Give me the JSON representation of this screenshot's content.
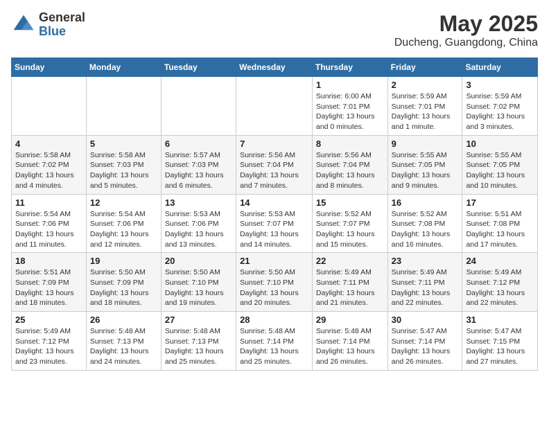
{
  "header": {
    "logo_general": "General",
    "logo_blue": "Blue",
    "month_year": "May 2025",
    "location": "Ducheng, Guangdong, China"
  },
  "weekdays": [
    "Sunday",
    "Monday",
    "Tuesday",
    "Wednesday",
    "Thursday",
    "Friday",
    "Saturday"
  ],
  "weeks": [
    [
      {
        "day": "",
        "info": ""
      },
      {
        "day": "",
        "info": ""
      },
      {
        "day": "",
        "info": ""
      },
      {
        "day": "",
        "info": ""
      },
      {
        "day": "1",
        "info": "Sunrise: 6:00 AM\nSunset: 7:01 PM\nDaylight: 13 hours and 0 minutes."
      },
      {
        "day": "2",
        "info": "Sunrise: 5:59 AM\nSunset: 7:01 PM\nDaylight: 13 hours and 1 minute."
      },
      {
        "day": "3",
        "info": "Sunrise: 5:59 AM\nSunset: 7:02 PM\nDaylight: 13 hours and 3 minutes."
      }
    ],
    [
      {
        "day": "4",
        "info": "Sunrise: 5:58 AM\nSunset: 7:02 PM\nDaylight: 13 hours and 4 minutes."
      },
      {
        "day": "5",
        "info": "Sunrise: 5:58 AM\nSunset: 7:03 PM\nDaylight: 13 hours and 5 minutes."
      },
      {
        "day": "6",
        "info": "Sunrise: 5:57 AM\nSunset: 7:03 PM\nDaylight: 13 hours and 6 minutes."
      },
      {
        "day": "7",
        "info": "Sunrise: 5:56 AM\nSunset: 7:04 PM\nDaylight: 13 hours and 7 minutes."
      },
      {
        "day": "8",
        "info": "Sunrise: 5:56 AM\nSunset: 7:04 PM\nDaylight: 13 hours and 8 minutes."
      },
      {
        "day": "9",
        "info": "Sunrise: 5:55 AM\nSunset: 7:05 PM\nDaylight: 13 hours and 9 minutes."
      },
      {
        "day": "10",
        "info": "Sunrise: 5:55 AM\nSunset: 7:05 PM\nDaylight: 13 hours and 10 minutes."
      }
    ],
    [
      {
        "day": "11",
        "info": "Sunrise: 5:54 AM\nSunset: 7:06 PM\nDaylight: 13 hours and 11 minutes."
      },
      {
        "day": "12",
        "info": "Sunrise: 5:54 AM\nSunset: 7:06 PM\nDaylight: 13 hours and 12 minutes."
      },
      {
        "day": "13",
        "info": "Sunrise: 5:53 AM\nSunset: 7:06 PM\nDaylight: 13 hours and 13 minutes."
      },
      {
        "day": "14",
        "info": "Sunrise: 5:53 AM\nSunset: 7:07 PM\nDaylight: 13 hours and 14 minutes."
      },
      {
        "day": "15",
        "info": "Sunrise: 5:52 AM\nSunset: 7:07 PM\nDaylight: 13 hours and 15 minutes."
      },
      {
        "day": "16",
        "info": "Sunrise: 5:52 AM\nSunset: 7:08 PM\nDaylight: 13 hours and 16 minutes."
      },
      {
        "day": "17",
        "info": "Sunrise: 5:51 AM\nSunset: 7:08 PM\nDaylight: 13 hours and 17 minutes."
      }
    ],
    [
      {
        "day": "18",
        "info": "Sunrise: 5:51 AM\nSunset: 7:09 PM\nDaylight: 13 hours and 18 minutes."
      },
      {
        "day": "19",
        "info": "Sunrise: 5:50 AM\nSunset: 7:09 PM\nDaylight: 13 hours and 18 minutes."
      },
      {
        "day": "20",
        "info": "Sunrise: 5:50 AM\nSunset: 7:10 PM\nDaylight: 13 hours and 19 minutes."
      },
      {
        "day": "21",
        "info": "Sunrise: 5:50 AM\nSunset: 7:10 PM\nDaylight: 13 hours and 20 minutes."
      },
      {
        "day": "22",
        "info": "Sunrise: 5:49 AM\nSunset: 7:11 PM\nDaylight: 13 hours and 21 minutes."
      },
      {
        "day": "23",
        "info": "Sunrise: 5:49 AM\nSunset: 7:11 PM\nDaylight: 13 hours and 22 minutes."
      },
      {
        "day": "24",
        "info": "Sunrise: 5:49 AM\nSunset: 7:12 PM\nDaylight: 13 hours and 22 minutes."
      }
    ],
    [
      {
        "day": "25",
        "info": "Sunrise: 5:49 AM\nSunset: 7:12 PM\nDaylight: 13 hours and 23 minutes."
      },
      {
        "day": "26",
        "info": "Sunrise: 5:48 AM\nSunset: 7:13 PM\nDaylight: 13 hours and 24 minutes."
      },
      {
        "day": "27",
        "info": "Sunrise: 5:48 AM\nSunset: 7:13 PM\nDaylight: 13 hours and 25 minutes."
      },
      {
        "day": "28",
        "info": "Sunrise: 5:48 AM\nSunset: 7:14 PM\nDaylight: 13 hours and 25 minutes."
      },
      {
        "day": "29",
        "info": "Sunrise: 5:48 AM\nSunset: 7:14 PM\nDaylight: 13 hours and 26 minutes."
      },
      {
        "day": "30",
        "info": "Sunrise: 5:47 AM\nSunset: 7:14 PM\nDaylight: 13 hours and 26 minutes."
      },
      {
        "day": "31",
        "info": "Sunrise: 5:47 AM\nSunset: 7:15 PM\nDaylight: 13 hours and 27 minutes."
      }
    ]
  ]
}
